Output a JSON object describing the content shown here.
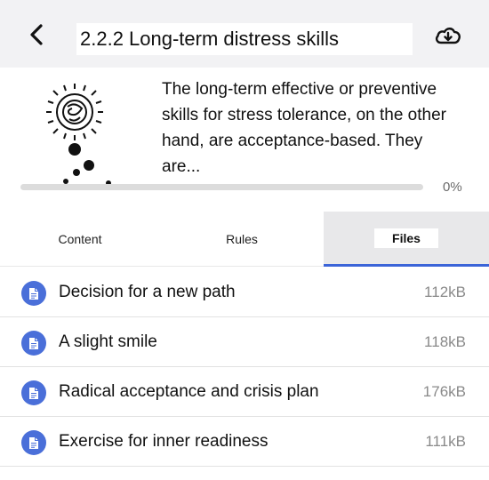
{
  "header": {
    "title": "2.2.2 Long-term distress skills",
    "back_icon": "chevron-left-icon",
    "download_icon": "cloud-download-icon"
  },
  "intro": {
    "description": "The long-term effective or preventive skills for stress tolerance, on the other hand, are acceptance-based. They are...",
    "thumbnail_icon": "sketch-illustration",
    "progress": {
      "value": 0,
      "label": "0%"
    }
  },
  "tabs": [
    {
      "label": "Content",
      "active": false
    },
    {
      "label": "Rules",
      "active": false
    },
    {
      "label": "Files",
      "active": true
    }
  ],
  "files": [
    {
      "name": "Decision for a new path",
      "size": "112kB"
    },
    {
      "name": "A slight smile",
      "size": "118kB"
    },
    {
      "name": "Radical acceptance and crisis plan",
      "size": "176kB"
    },
    {
      "name": "Exercise for inner readiness",
      "size": "111kB"
    }
  ],
  "colors": {
    "accent": "#3b64d8",
    "file_icon_bg": "#4a6fd9",
    "header_bg": "#f2f2f4",
    "active_tab_bg": "#e8e8ea"
  }
}
